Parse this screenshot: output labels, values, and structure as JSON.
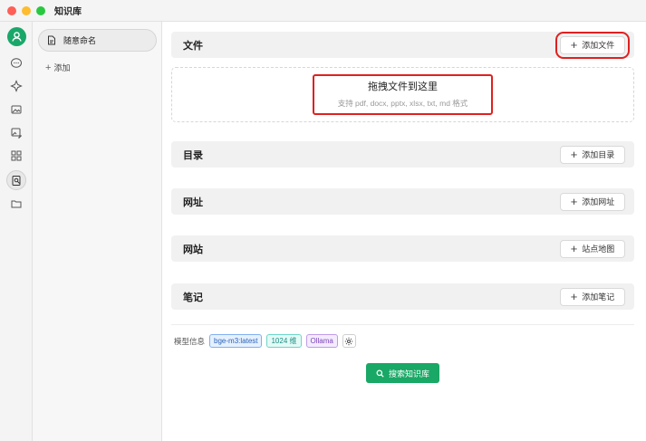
{
  "app": {
    "title": "知识库"
  },
  "sidebar": {
    "knowledge_base_name": "随意命名",
    "add_label": "添加"
  },
  "sections": {
    "files": {
      "title": "文件",
      "button": "添加文件"
    },
    "dropzone": {
      "title": "拖拽文件到这里",
      "subtitle": "支持 pdf, docx, pptx, xlsx, txt, md 格式"
    },
    "directory": {
      "title": "目录",
      "button": "添加目录"
    },
    "url": {
      "title": "网址",
      "button": "添加网址"
    },
    "website": {
      "title": "网站",
      "button": "站点地图"
    },
    "notes": {
      "title": "笔记",
      "button": "添加笔记"
    }
  },
  "model_info": {
    "label": "模型信息",
    "model": "bge-m3:latest",
    "dimensions": "1024 维",
    "provider": "Ollama"
  },
  "search_button": "搜索知识库",
  "colors": {
    "accent": "#19a865",
    "highlight": "#e02020"
  }
}
